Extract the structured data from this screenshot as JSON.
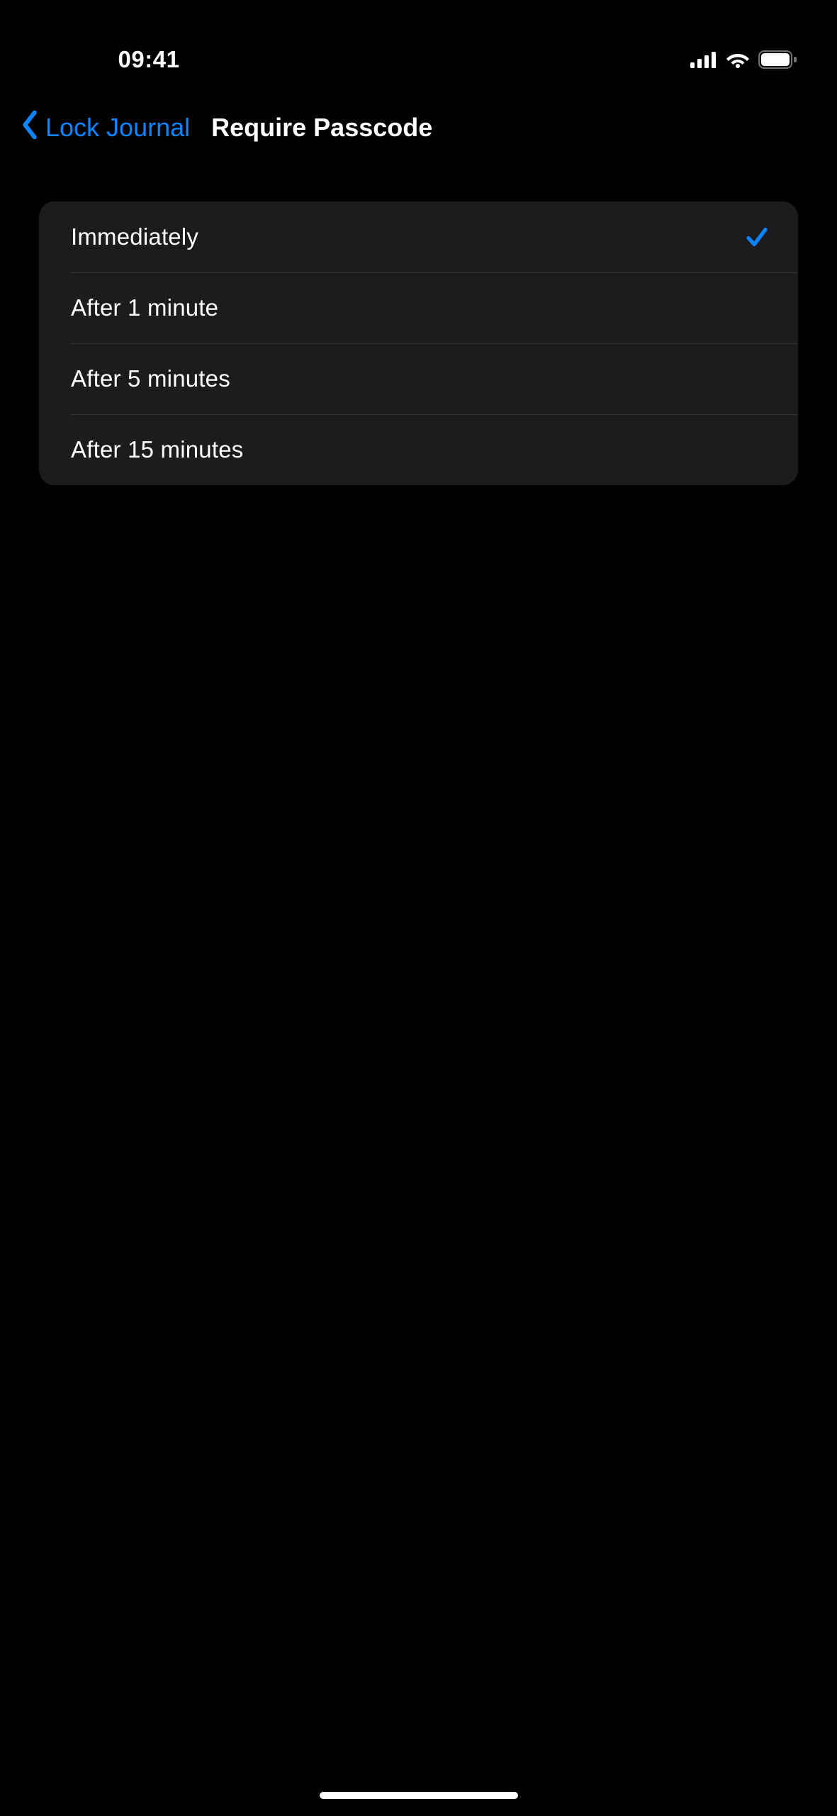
{
  "status": {
    "time": "09:41"
  },
  "nav": {
    "back_label": "Lock Journal",
    "title": "Require Passcode"
  },
  "options": [
    {
      "label": "Immediately",
      "selected": true
    },
    {
      "label": "After 1 minute",
      "selected": false
    },
    {
      "label": "After 5 minutes",
      "selected": false
    },
    {
      "label": "After 15 minutes",
      "selected": false
    }
  ],
  "colors": {
    "accent": "#0A84FF",
    "bg": "#000000",
    "group_bg": "#1C1C1E"
  }
}
